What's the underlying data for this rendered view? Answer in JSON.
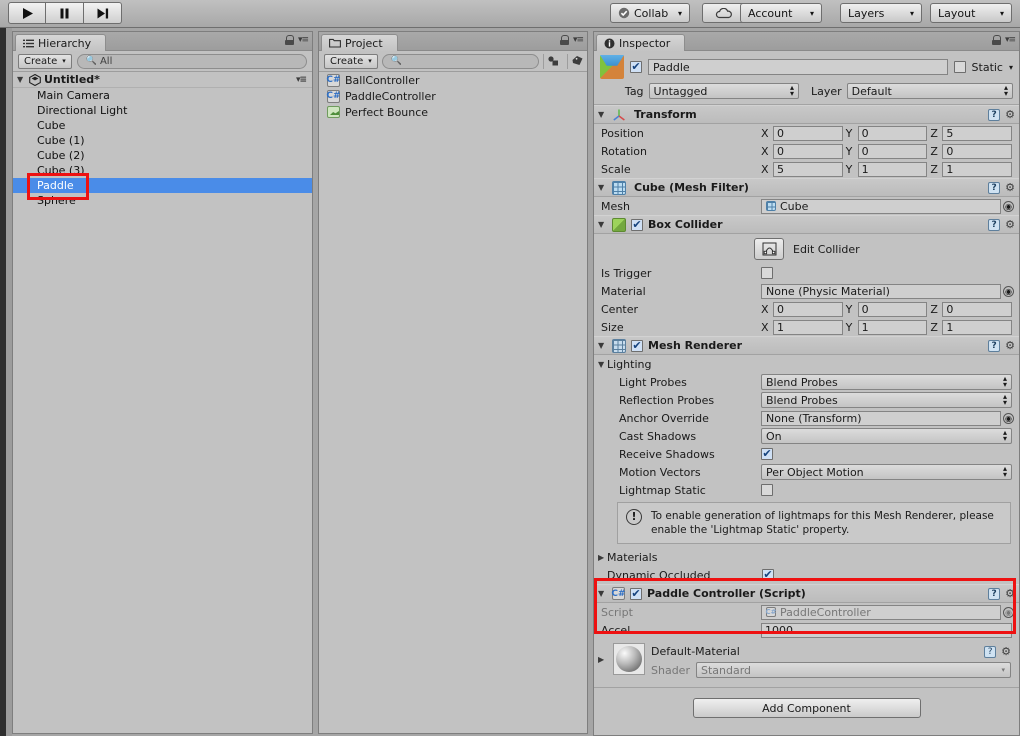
{
  "toolbar": {
    "play_icon": "play-icon",
    "pause_icon": "pause-icon",
    "step_icon": "step-icon",
    "collab_label": "Collab",
    "cloud_icon": "cloud-icon",
    "account_label": "Account",
    "layers_label": "Layers",
    "layout_label": "Layout",
    "caret": "▾"
  },
  "hierarchy": {
    "tab_label": "Hierarchy",
    "tab_icon": "hierarchy-icon",
    "create_label": "Create",
    "search_placeholder": "All",
    "search_icon": "search-icon",
    "scene_name": "Untitled*",
    "items": [
      {
        "label": "Main Camera",
        "selected": false
      },
      {
        "label": "Directional Light",
        "selected": false
      },
      {
        "label": "Cube",
        "selected": false
      },
      {
        "label": "Cube (1)",
        "selected": false
      },
      {
        "label": "Cube (2)",
        "selected": false
      },
      {
        "label": "Cube (3)",
        "selected": false
      },
      {
        "label": "Paddle",
        "selected": true
      },
      {
        "label": "Sphere",
        "selected": false
      }
    ]
  },
  "project": {
    "tab_label": "Project",
    "tab_icon": "folder-icon",
    "create_label": "Create",
    "search_placeholder": "",
    "items": [
      {
        "label": "BallController",
        "icon": "csharp-script-icon"
      },
      {
        "label": "PaddleController",
        "icon": "csharp-script-icon"
      },
      {
        "label": "Perfect Bounce",
        "icon": "unity-scene-icon"
      }
    ]
  },
  "inspector": {
    "tab_label": "Inspector",
    "tab_icon": "info-icon",
    "object": {
      "enabled": true,
      "name": "Paddle",
      "static_label": "Static",
      "static_checked": false,
      "tag_label": "Tag",
      "tag_value": "Untagged",
      "layer_label": "Layer",
      "layer_value": "Default"
    },
    "transform": {
      "title": "Transform",
      "rows": [
        {
          "label": "Position",
          "x": "0",
          "y": "0",
          "z": "5"
        },
        {
          "label": "Rotation",
          "x": "0",
          "y": "0",
          "z": "0"
        },
        {
          "label": "Scale",
          "x": "5",
          "y": "1",
          "z": "1"
        }
      ],
      "axes": [
        "X",
        "Y",
        "Z"
      ]
    },
    "mesh_filter": {
      "title": "Cube (Mesh Filter)",
      "mesh_label": "Mesh",
      "mesh_value": "Cube"
    },
    "box_collider": {
      "title": "Box Collider",
      "enabled": true,
      "edit_collider_label": "Edit Collider",
      "is_trigger_label": "Is Trigger",
      "is_trigger_checked": false,
      "material_label": "Material",
      "material_value": "None (Physic Material)",
      "center": {
        "label": "Center",
        "x": "0",
        "y": "0",
        "z": "0"
      },
      "size": {
        "label": "Size",
        "x": "1",
        "y": "1",
        "z": "1"
      }
    },
    "mesh_renderer": {
      "title": "Mesh Renderer",
      "enabled": true,
      "lighting_label": "Lighting",
      "light_probes_label": "Light Probes",
      "light_probes_value": "Blend Probes",
      "reflection_probes_label": "Reflection Probes",
      "reflection_probes_value": "Blend Probes",
      "anchor_override_label": "Anchor Override",
      "anchor_override_value": "None (Transform)",
      "cast_shadows_label": "Cast Shadows",
      "cast_shadows_value": "On",
      "receive_shadows_label": "Receive Shadows",
      "receive_shadows_checked": true,
      "motion_vectors_label": "Motion Vectors",
      "motion_vectors_value": "Per Object Motion",
      "lightmap_static_label": "Lightmap Static",
      "lightmap_static_checked": false,
      "help_text": "To enable generation of lightmaps for this Mesh Renderer, please enable the 'Lightmap Static' property.",
      "materials_label": "Materials",
      "dynamic_occluded_label": "Dynamic Occluded",
      "dynamic_occluded_checked": true
    },
    "paddle_controller": {
      "title": "Paddle Controller (Script)",
      "enabled": true,
      "script_label": "Script",
      "script_value": "PaddleController",
      "accel_label": "Accel",
      "accel_value": "1000"
    },
    "material": {
      "name": "Default-Material",
      "shader_label": "Shader",
      "shader_value": "Standard"
    },
    "add_component_label": "Add Component"
  },
  "annotations": {
    "highlight_color": "#ee1111",
    "selection_color": "#4a8ce8"
  }
}
